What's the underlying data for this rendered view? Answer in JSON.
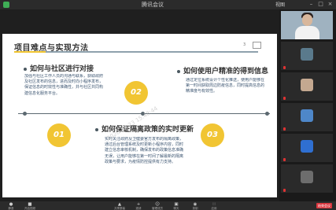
{
  "window": {
    "title": "腾讯会议",
    "view_label": "视图",
    "controls": [
      "–",
      "□",
      "×"
    ]
  },
  "slide": {
    "title": "项目难点与实现方法",
    "page": "3",
    "watermark": "2020-12-23 15:48:44",
    "sections": [
      {
        "heading": "如何与社区进行对接",
        "body": "加强与社区工作人员的沟通与联系，获取政府及社区发布的信息，进而及时向小程序发布，保证信息的时效性与准确性，并与社区共同构建信息化服务平台。",
        "number": "02"
      },
      {
        "heading": "如何使用户精准的得到信息",
        "body": "通过定位系统设计个性化推送，使用户能够在第一时间获取周边防疫信息，同时提高信息的精准度与有效性。",
        "number": "03"
      },
      {
        "heading": "如何保证隔离政策的实时更新",
        "body": "实时关注政府及卫健委官方发布的隔离政策，通过后台管理系统及时更新小程序内容，同时建立信息审核机制，确保发布的政策信息准确无误，让用户能够在第一时间了解最新的隔离政策与要求，为疫情防控提供有力支持。",
        "number": "01"
      }
    ]
  },
  "participants": [
    {
      "name": "",
      "avatar_color": "",
      "video": true
    },
    {
      "name": "",
      "avatar_color": "#5a7a8c",
      "video": false
    },
    {
      "name": "",
      "avatar_color": "#c4a890",
      "video": false
    },
    {
      "name": "",
      "avatar_color": "#4e87c9",
      "video": false
    },
    {
      "name": "",
      "avatar_color": "#2f6fd1",
      "video": false
    },
    {
      "name": "",
      "avatar_color": "#6d6d6d",
      "video": false
    },
    {
      "name": "",
      "avatar_color": "#3d8a5c",
      "video": false
    }
  ],
  "bottom_bar": {
    "items": [
      {
        "icon": "mic-icon",
        "glyph": "●",
        "label": "静音"
      },
      {
        "icon": "camera-icon",
        "glyph": "■",
        "label": "开启视频"
      },
      {
        "icon": "share-icon",
        "glyph": "▲",
        "label": "共享屏幕"
      },
      {
        "icon": "invite-icon",
        "glyph": "+",
        "label": "邀请"
      },
      {
        "icon": "members-icon",
        "glyph": "☺",
        "label": "管理成员"
      },
      {
        "icon": "chat-icon",
        "glyph": "▣",
        "label": "聊天"
      },
      {
        "icon": "record-icon",
        "glyph": "◉",
        "label": "录制"
      },
      {
        "icon": "apps-icon",
        "glyph": "∷",
        "label": "应用"
      }
    ],
    "end_label": "结束会议"
  },
  "colors": {
    "accent": "#f1c533",
    "end_button": "#d9363e",
    "heading": "#333333",
    "body_text": "#3b5470"
  }
}
